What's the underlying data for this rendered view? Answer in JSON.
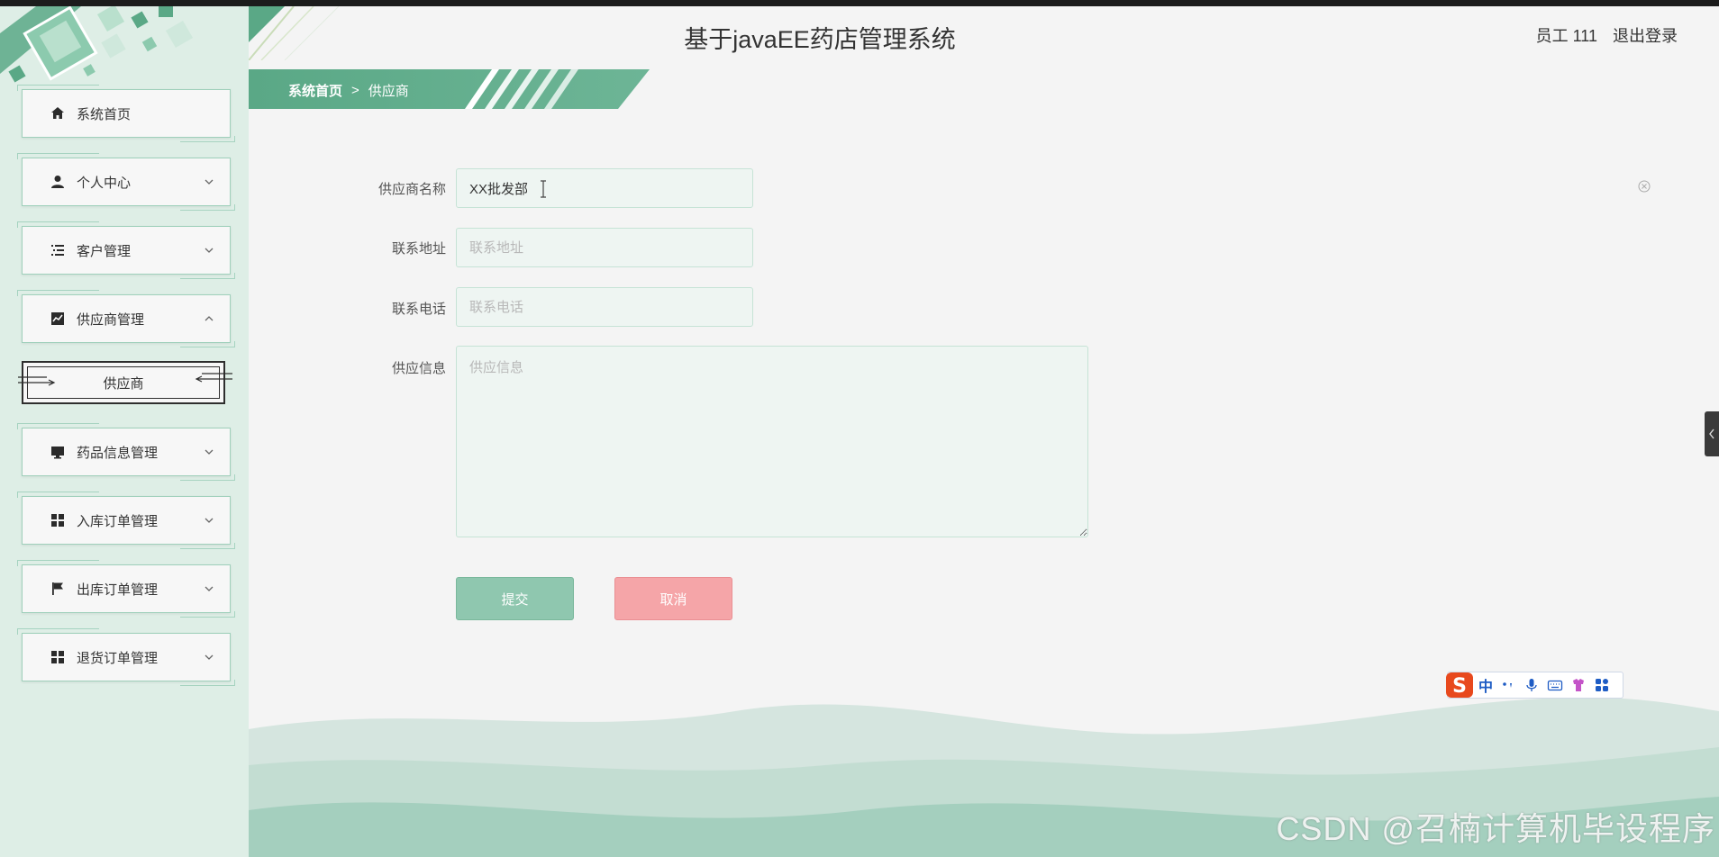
{
  "header": {
    "title": "基于javaEE药店管理系统",
    "user": "员工 111",
    "logout": "退出登录"
  },
  "breadcrumb": {
    "home": "系统首页",
    "separator": ">",
    "current": "供应商"
  },
  "sidebar": {
    "items": [
      {
        "label": "系统首页",
        "icon": "home-icon"
      },
      {
        "label": "个人中心",
        "icon": "user-icon"
      },
      {
        "label": "客户管理",
        "icon": "list-icon"
      },
      {
        "label": "供应商管理",
        "icon": "chart-icon"
      },
      {
        "label": "药品信息管理",
        "icon": "monitor-icon"
      },
      {
        "label": "入库订单管理",
        "icon": "grid-icon"
      },
      {
        "label": "出库订单管理",
        "icon": "flag-icon"
      },
      {
        "label": "退货订单管理",
        "icon": "grid-icon"
      }
    ],
    "submenu": {
      "label": "供应商"
    }
  },
  "form": {
    "supplier_name_label": "供应商名称",
    "supplier_name_value": "XX批发部",
    "address_label": "联系地址",
    "address_placeholder": "联系地址",
    "phone_label": "联系电话",
    "phone_placeholder": "联系电话",
    "info_label": "供应信息",
    "info_placeholder": "供应信息",
    "submit": "提交",
    "cancel": "取消"
  },
  "ime": {
    "mode": "中"
  },
  "watermark": "CSDN @召楠计算机毕设程序",
  "colors": {
    "accent": "#5aa886",
    "sidebar_bg": "#deeee6",
    "submit": "#8fc7af",
    "cancel": "#f5a5a8"
  }
}
